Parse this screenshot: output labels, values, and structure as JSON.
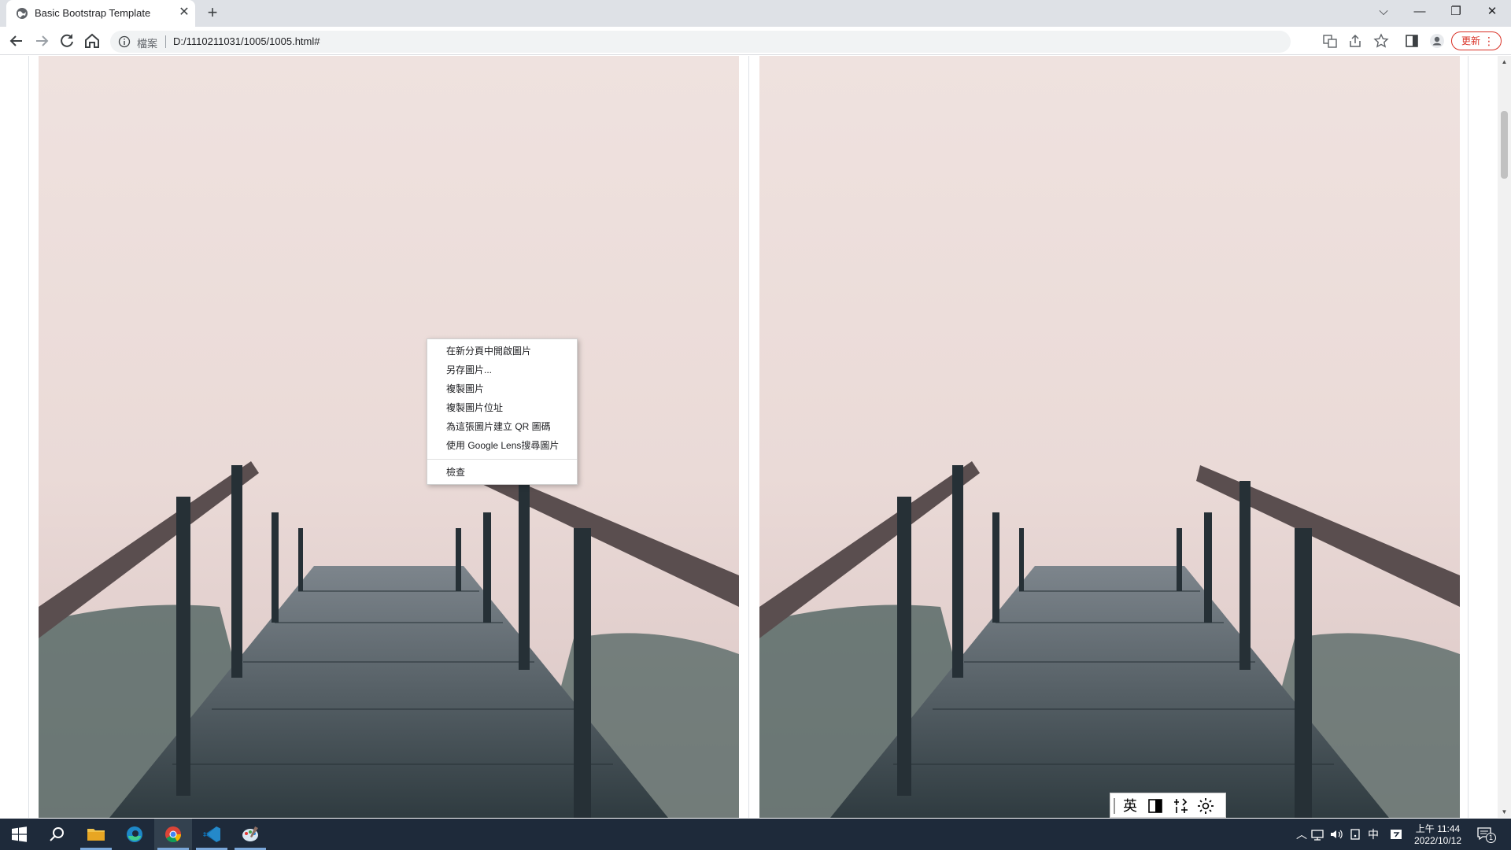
{
  "browser": {
    "tab_title": "Basic Bootstrap Template",
    "close_glyph": "✕",
    "new_tab_glyph": "+",
    "scheme_label": "檔案",
    "url": "D:/1110211031/1005/1005.html#",
    "update_label": "更新",
    "window_controls": {
      "dropdown": "⌵",
      "minimize": "—",
      "restore": "❐",
      "close": "✕"
    },
    "toolbar_icons": [
      "back-icon",
      "forward-icon",
      "reload-icon",
      "home-icon"
    ]
  },
  "context_menu": {
    "items": [
      "在新分頁中開啟圖片",
      "另存圖片...",
      "複製圖片",
      "複製圖片位址",
      "為這張圖片建立 QR 圖碼",
      "使用 Google Lens搜尋圖片"
    ],
    "inspect": "檢查"
  },
  "ime": {
    "lang": "英",
    "icons": [
      "half-full-width-icon",
      "tools-icon",
      "settings-icon"
    ]
  },
  "taskbar": {
    "apps": [
      "windows-start-icon",
      "search-icon",
      "file-explorer-icon",
      "edge-icon",
      "chrome-icon",
      "vscode-icon",
      "paint-icon"
    ],
    "tray_lang": "中",
    "time": "上午 11:44",
    "date": "2022/10/12",
    "notification_count": "1"
  },
  "colors": {
    "accent_red": "#d93025",
    "taskbar_bg": "#1e2a3a",
    "sky_top": "#efe2df",
    "deck_dark": "#3d4a4f"
  }
}
